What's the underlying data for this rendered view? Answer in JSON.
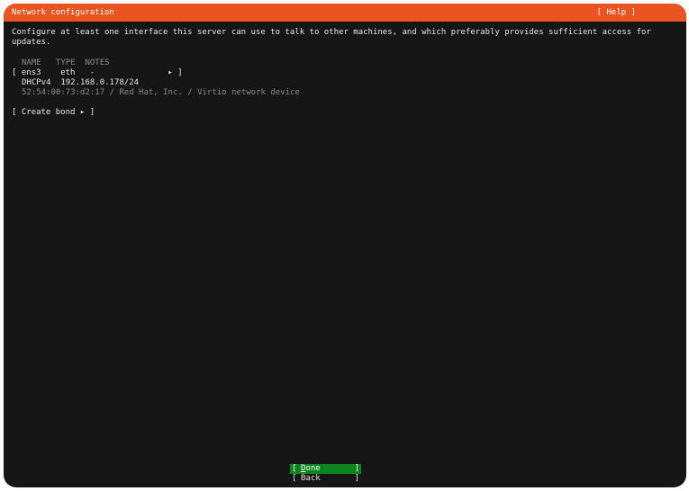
{
  "header": {
    "title": "Network configuration",
    "help": "[ Help ]"
  },
  "description": "Configure at least one interface this server can use to talk to other machines, and which preferably provides sufficient access for updates.",
  "table": {
    "columns": [
      "NAME",
      "TYPE",
      "NOTES"
    ],
    "header_line": "NAME   TYPE  NOTES",
    "interfaces": [
      {
        "name": "ens3",
        "type": "eth",
        "notes": "-",
        "line": "[ ens3    eth   -               ▸ ]",
        "address_line": "DHCPv4  192.168.0.178/24",
        "hw_line": "52:54:00:73:d2:17 / Red Hat, Inc. / Virtio network device"
      }
    ]
  },
  "actions": {
    "create_bond": "[ Create bond ▸ ]"
  },
  "buttons": {
    "done_first": "D",
    "done_rest": "one",
    "back": "Back",
    "bracket_l": "[",
    "bracket_r": "]"
  },
  "colors": {
    "accent": "#e95420",
    "selected": "#0e8420",
    "background": "#161616"
  }
}
